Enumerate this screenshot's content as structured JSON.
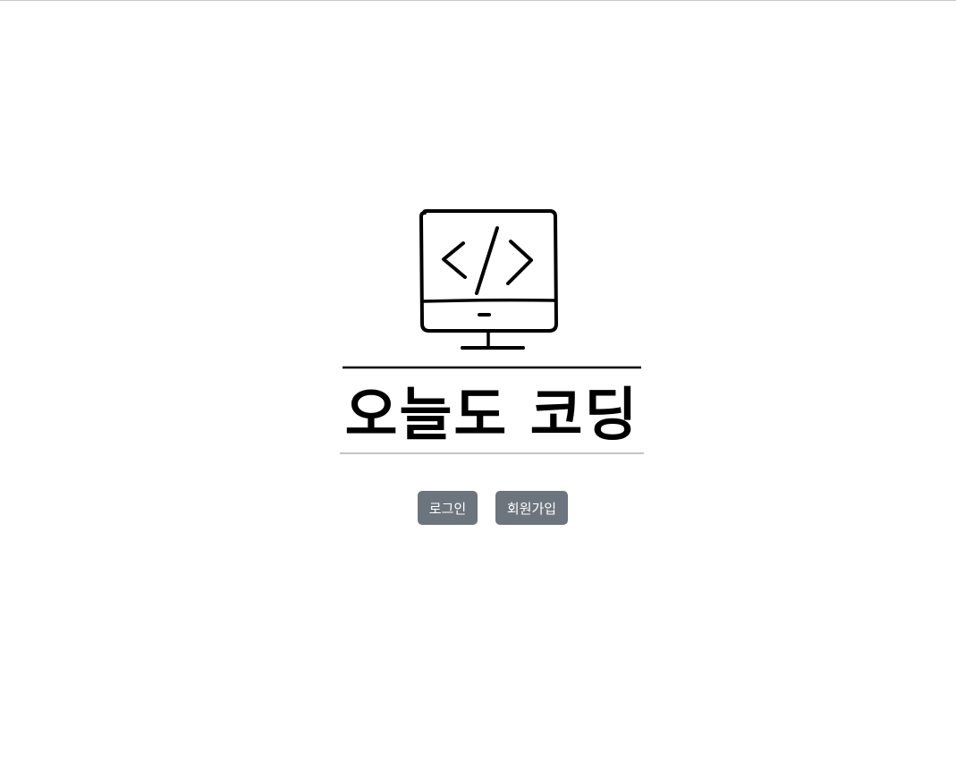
{
  "logo": {
    "icon": "monitor-code-icon",
    "title": "오늘도 코딩"
  },
  "actions": {
    "login_label": "로그인",
    "signup_label": "회원가입"
  },
  "colors": {
    "button_bg": "#6c757d",
    "button_text": "#ffffff",
    "ink": "#000000"
  }
}
